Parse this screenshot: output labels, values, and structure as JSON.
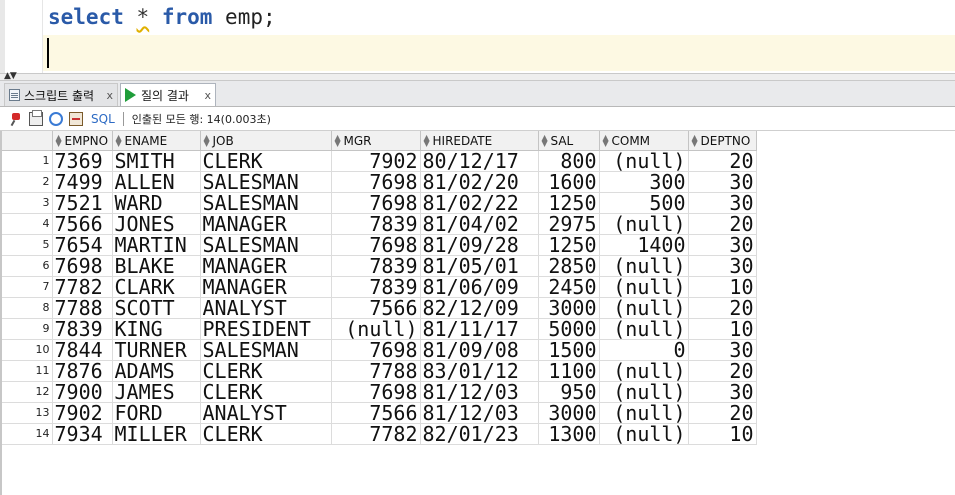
{
  "editor": {
    "keyword_select": "select",
    "star": "*",
    "keyword_from": "from",
    "table_and_end": " emp;"
  },
  "splitter": {
    "arrows": "▲▼"
  },
  "tabs": [
    {
      "label": "스크립트 출력",
      "close": "x",
      "active": false
    },
    {
      "label": "질의 결과",
      "close": "x",
      "active": true
    }
  ],
  "toolbar": {
    "sql_label": "SQL",
    "status": "인출된 모든 행: 14(0.003초)"
  },
  "grid": {
    "columns": [
      "EMPNO",
      "ENAME",
      "JOB",
      "MGR",
      "HIREDATE",
      "SAL",
      "COMM",
      "DEPTNO"
    ],
    "rows": [
      [
        "1",
        "7369",
        "SMITH",
        "CLERK",
        "7902",
        "80/12/17",
        "800",
        "(null)",
        "20"
      ],
      [
        "2",
        "7499",
        "ALLEN",
        "SALESMAN",
        "7698",
        "81/02/20",
        "1600",
        "300",
        "30"
      ],
      [
        "3",
        "7521",
        "WARD",
        "SALESMAN",
        "7698",
        "81/02/22",
        "1250",
        "500",
        "30"
      ],
      [
        "4",
        "7566",
        "JONES",
        "MANAGER",
        "7839",
        "81/04/02",
        "2975",
        "(null)",
        "20"
      ],
      [
        "5",
        "7654",
        "MARTIN",
        "SALESMAN",
        "7698",
        "81/09/28",
        "1250",
        "1400",
        "30"
      ],
      [
        "6",
        "7698",
        "BLAKE",
        "MANAGER",
        "7839",
        "81/05/01",
        "2850",
        "(null)",
        "30"
      ],
      [
        "7",
        "7782",
        "CLARK",
        "MANAGER",
        "7839",
        "81/06/09",
        "2450",
        "(null)",
        "10"
      ],
      [
        "8",
        "7788",
        "SCOTT",
        "ANALYST",
        "7566",
        "82/12/09",
        "3000",
        "(null)",
        "20"
      ],
      [
        "9",
        "7839",
        "KING",
        "PRESIDENT",
        "(null)",
        "81/11/17",
        "5000",
        "(null)",
        "10"
      ],
      [
        "10",
        "7844",
        "TURNER",
        "SALESMAN",
        "7698",
        "81/09/08",
        "1500",
        "0",
        "30"
      ],
      [
        "11",
        "7876",
        "ADAMS",
        "CLERK",
        "7788",
        "83/01/12",
        "1100",
        "(null)",
        "20"
      ],
      [
        "12",
        "7900",
        "JAMES",
        "CLERK",
        "7698",
        "81/12/03",
        "950",
        "(null)",
        "30"
      ],
      [
        "13",
        "7902",
        "FORD",
        "ANALYST",
        "7566",
        "81/12/03",
        "3000",
        "(null)",
        "20"
      ],
      [
        "14",
        "7934",
        "MILLER",
        "CLERK",
        "7782",
        "82/01/23",
        "1300",
        "(null)",
        "10"
      ]
    ]
  }
}
